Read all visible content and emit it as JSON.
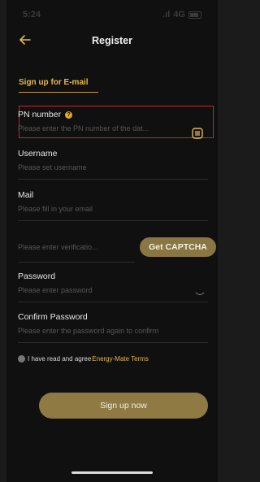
{
  "status": {
    "time": "5:24",
    "signal": "4G"
  },
  "header": {
    "title": "Register"
  },
  "tab": {
    "label": "Sign up for E-mail"
  },
  "pn": {
    "label": "PN number",
    "placeholder": "Please enter the PN number of the dat..."
  },
  "username": {
    "label": "Username",
    "placeholder": "Please set username"
  },
  "mail": {
    "label": "Mail",
    "placeholder": "Please fill in your email"
  },
  "verification": {
    "placeholder": "Please enter verificatio...",
    "button": "Get CAPTCHA"
  },
  "password": {
    "label": "Password",
    "placeholder": "Please enter password"
  },
  "confirm": {
    "label": "Confirm Password",
    "placeholder": "Please enter the password again to confirm"
  },
  "agreement": {
    "text": "I have read and agree",
    "link": "Energy-Mate Terms"
  },
  "actions": {
    "signup": "Sign up now"
  },
  "colors": {
    "accent": "#e5b84b",
    "button": "#8f7a44",
    "highlight": "#c0282f"
  },
  "icons": {
    "back": "arrow-left-icon",
    "help": "question-icon",
    "scan": "scan-icon",
    "eye": "eye-closed-icon"
  }
}
